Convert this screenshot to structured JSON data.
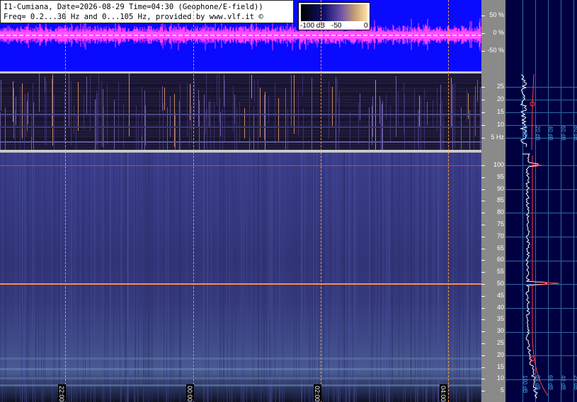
{
  "header": {
    "line1": "I1-Cumiana, Date=2026-08-29 Time=04:30 (Geophone/E-field))",
    "line2": "Freq= 0.2...30 Hz and 0...105 Hz, provided by www.vlf.it ©"
  },
  "colorbar": {
    "label_min": "-100 dB",
    "label_mid": "-50",
    "label_max": "0"
  },
  "amplitude_axis": [
    "50 %",
    "0 %",
    "-50 %"
  ],
  "elf_axis": [
    "25",
    "20",
    "15",
    "10",
    "5 Hz"
  ],
  "main_axis": [
    "100",
    "95",
    "90",
    "85",
    "80",
    "75",
    "70",
    "65",
    "60",
    "55",
    "50",
    "45",
    "40",
    "35",
    "30",
    "25",
    "20",
    "15",
    "10",
    "5"
  ],
  "time_labels": [
    "22:00",
    "00:00",
    "02:00",
    "04:00"
  ],
  "side_db_labels_top": [
    "0 dB",
    "20 dB",
    "40 dB",
    "60 dB",
    "80 dB"
  ],
  "side_db_labels_bottom": [
    "100 dB",
    "80 dB",
    "60 dB",
    "40 dB",
    "20 dB"
  ],
  "colors": {
    "waveform_bg": "#0a0aff",
    "waveform_trace": "#ff40ff",
    "marker_line": "#ff9a40",
    "power_line": "#ff4040",
    "axis_bg": "#8a8a8a",
    "side_bg": "#000040",
    "grid": "#2e6aa8"
  }
}
